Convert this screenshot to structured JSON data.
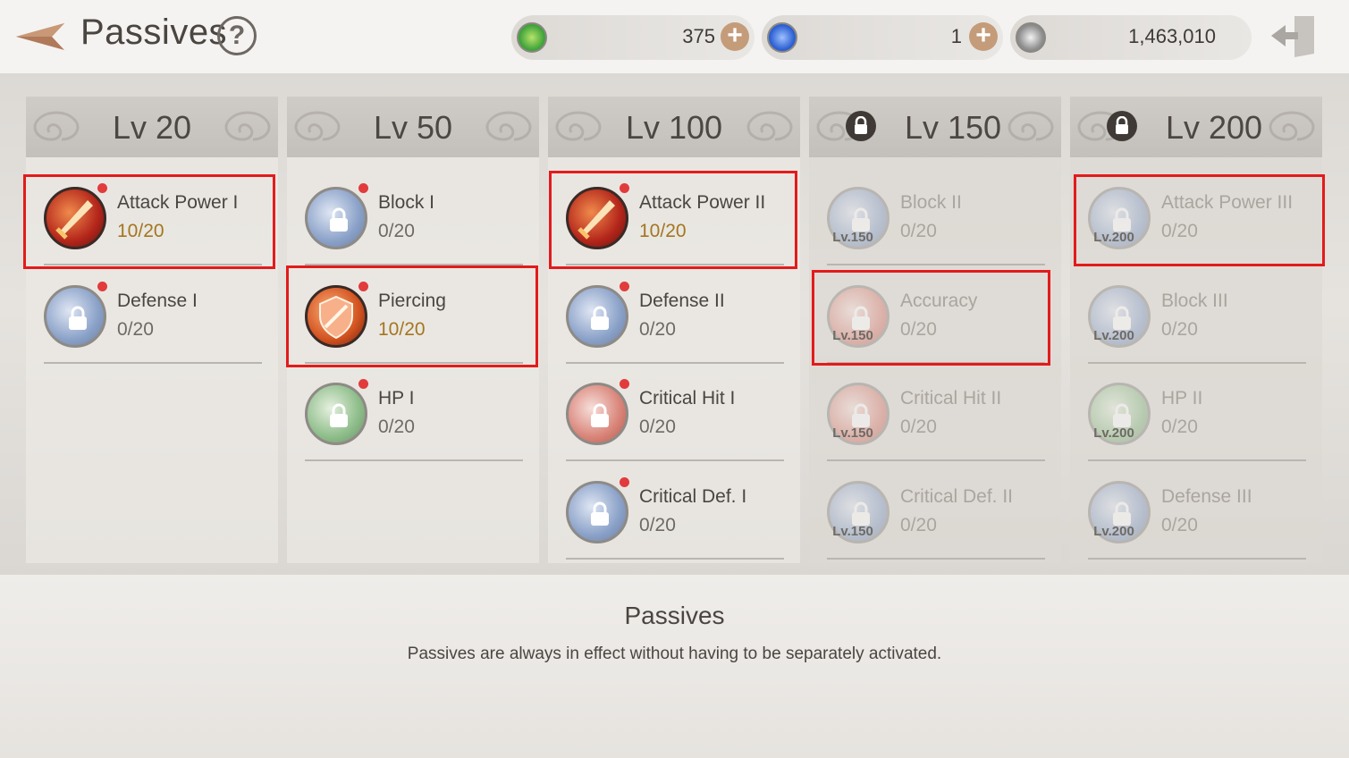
{
  "header": {
    "title": "Passives",
    "help_label": "?"
  },
  "resources": [
    {
      "icon": "green-swirl-currency-icon",
      "value": "375",
      "color": "#3fa33a",
      "has_plus": true
    },
    {
      "icon": "blue-orb-currency-icon",
      "value": "1",
      "color": "#2b5fd1",
      "has_plus": true
    },
    {
      "icon": "silver-coin-icon",
      "value": "1,463,010",
      "color": "#8c8c8c",
      "has_plus": false
    }
  ],
  "columns": [
    {
      "title": "Lv 20",
      "locked": false,
      "skills": [
        {
          "name": "Attack Power I",
          "progress": "10/20",
          "active": true,
          "icon": "sword-icon"
        },
        {
          "name": "Defense I",
          "progress": "0/20",
          "active": false,
          "icon": "shield-lock-icon"
        }
      ]
    },
    {
      "title": "Lv 50",
      "locked": false,
      "skills": [
        {
          "name": "Block I",
          "progress": "0/20",
          "active": false,
          "icon": "shield-lock-icon"
        },
        {
          "name": "Piercing",
          "progress": "10/20",
          "active": true,
          "icon": "pierce-shield-icon"
        },
        {
          "name": "HP I",
          "progress": "0/20",
          "active": false,
          "icon": "leaf-lock-icon"
        }
      ]
    },
    {
      "title": "Lv 100",
      "locked": false,
      "skills": [
        {
          "name": "Attack Power II",
          "progress": "10/20",
          "active": true,
          "icon": "sword-icon"
        },
        {
          "name": "Defense II",
          "progress": "0/20",
          "active": false,
          "icon": "shield-lock-icon"
        },
        {
          "name": "Critical Hit I",
          "progress": "0/20",
          "active": false,
          "icon": "burst-lock-icon"
        },
        {
          "name": "Critical Def. I",
          "progress": "0/20",
          "active": false,
          "icon": "shield-lock-icon"
        }
      ]
    },
    {
      "title": "Lv 150",
      "locked": true,
      "lock_tag": "Lv.150",
      "skills": [
        {
          "name": "Block II",
          "progress": "0/20",
          "icon": "shield-lock-icon"
        },
        {
          "name": "Accuracy",
          "progress": "0/20",
          "icon": "target-lock-icon"
        },
        {
          "name": "Critical Hit II",
          "progress": "0/20",
          "icon": "burst-lock-icon"
        },
        {
          "name": "Critical Def. II",
          "progress": "0/20",
          "icon": "shield-lock-icon"
        }
      ]
    },
    {
      "title": "Lv 200",
      "locked": true,
      "lock_tag": "Lv.200",
      "skills": [
        {
          "name": "Attack Power III",
          "progress": "0/20",
          "icon": "sword-lock-icon"
        },
        {
          "name": "Block III",
          "progress": "0/20",
          "icon": "shield-lock-icon"
        },
        {
          "name": "HP II",
          "progress": "0/20",
          "icon": "leaf-lock-icon"
        },
        {
          "name": "Defense III",
          "progress": "0/20",
          "icon": "shield-lock-icon"
        }
      ]
    }
  ],
  "info": {
    "title": "Passives",
    "description": "Passives are always in effect without having to be separately activated."
  },
  "colors": {
    "highlight": "#e31b1b",
    "active_progress": "#a4761f",
    "notification_dot": "#e23b3b"
  }
}
